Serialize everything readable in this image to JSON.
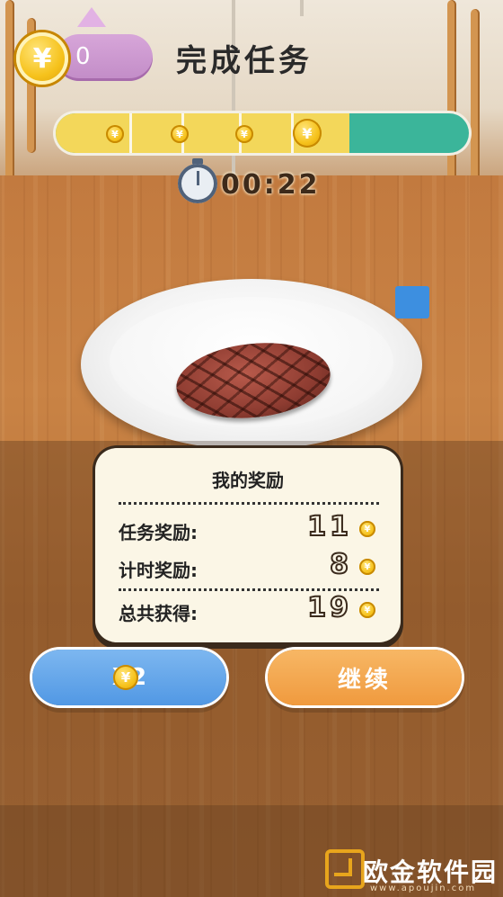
{
  "hud": {
    "coin_count": "0",
    "coin_symbol": "¥",
    "title": "完成任务",
    "timer": "00:22",
    "progress_fraction": 0.71,
    "progress_milestones": 4
  },
  "reward_card": {
    "title": "我的奖励",
    "rows": [
      {
        "label": "任务奖励:",
        "value": "11"
      },
      {
        "label": "计时奖励:",
        "value": "8"
      },
      {
        "label": "总共获得:",
        "value": "19"
      }
    ]
  },
  "buttons": {
    "double_label": "X2",
    "continue_label": "继续"
  },
  "watermark": {
    "text": "欧金软件园",
    "url": "www.apoujin.com"
  },
  "colors": {
    "progress_fill": "#f3d75a",
    "progress_track": "#3bb59a",
    "double_button": "#5198e4",
    "continue_button": "#f09a3e"
  },
  "icons": [
    "yen-coin-icon",
    "stopwatch-icon"
  ]
}
